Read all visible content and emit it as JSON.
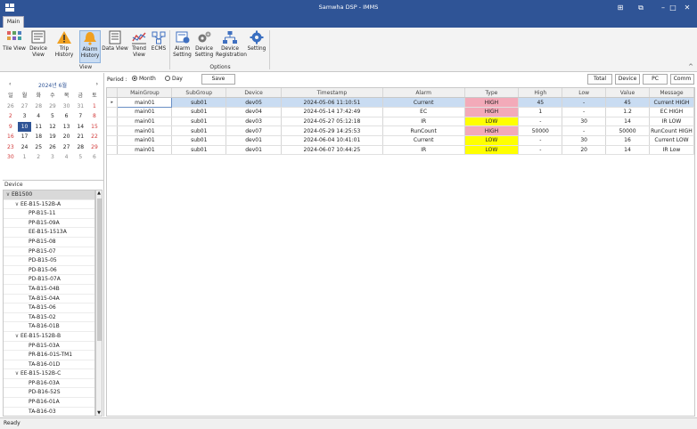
{
  "window": {
    "title": "Samwha DSP - IMMS"
  },
  "tabs": [
    "Main"
  ],
  "ribbon": {
    "buttons": [
      {
        "label": "Tile View",
        "icon": "tile-view-icon"
      },
      {
        "label": "Device View",
        "icon": "device-view-icon"
      },
      {
        "label": "Trip History",
        "icon": "warning-icon"
      },
      {
        "label": "Alarm History",
        "icon": "bell-icon"
      },
      {
        "label": "Data View",
        "icon": "document-icon"
      },
      {
        "label": "Trend View",
        "icon": "trend-icon"
      },
      {
        "label": "ECMS",
        "icon": "ecms-icon"
      },
      {
        "label": "Alarm Setting",
        "icon": "alarm-setting-icon"
      },
      {
        "label": "Device Setting",
        "icon": "gears-icon"
      },
      {
        "label": "Device Registration",
        "icon": "network-icon"
      },
      {
        "label": "Setting",
        "icon": "gear-icon"
      }
    ],
    "groups": [
      "View",
      "Options"
    ]
  },
  "calendar": {
    "month_label": "2024년 6월",
    "weekdays": [
      "일",
      "월",
      "화",
      "수",
      "목",
      "금",
      "토"
    ],
    "days": [
      [
        "26",
        "27",
        "28",
        "29",
        "30",
        "31",
        "1"
      ],
      [
        "2",
        "3",
        "4",
        "5",
        "6",
        "7",
        "8"
      ],
      [
        "9",
        "10",
        "11",
        "12",
        "13",
        "14",
        "15"
      ],
      [
        "16",
        "17",
        "18",
        "19",
        "20",
        "21",
        "22"
      ],
      [
        "23",
        "24",
        "25",
        "26",
        "27",
        "28",
        "29"
      ],
      [
        "30",
        "1",
        "2",
        "3",
        "4",
        "5",
        "6"
      ]
    ],
    "selected_day": "10"
  },
  "device_panel": {
    "header": "Device",
    "tree": [
      {
        "label": "EB1500",
        "level": 0,
        "toggle": "∨"
      },
      {
        "label": "EE-B15-152B-A",
        "level": 1,
        "toggle": "∨"
      },
      {
        "label": "PP-B15-11",
        "level": 2
      },
      {
        "label": "PP-B15-09A",
        "level": 2
      },
      {
        "label": "EE-B15-1513A",
        "level": 2
      },
      {
        "label": "PP-B15-08",
        "level": 2
      },
      {
        "label": "PP-B15-07",
        "level": 2
      },
      {
        "label": "PD-B15-05",
        "level": 2
      },
      {
        "label": "PD-B15-06",
        "level": 2
      },
      {
        "label": "PD-B15-07A",
        "level": 2
      },
      {
        "label": "TA-B15-04B",
        "level": 2
      },
      {
        "label": "TA-B15-04A",
        "level": 2
      },
      {
        "label": "TA-B15-06",
        "level": 2
      },
      {
        "label": "TA-B15-02",
        "level": 2
      },
      {
        "label": "TA-B16-01B",
        "level": 2
      },
      {
        "label": "EE-B15-152B-B",
        "level": 1,
        "toggle": "∨"
      },
      {
        "label": "PP-B15-03A",
        "level": 2
      },
      {
        "label": "PR-B16-01S-TM1",
        "level": 2
      },
      {
        "label": "TA-B16-01D",
        "level": 2
      },
      {
        "label": "EE-B15-152B-C",
        "level": 1,
        "toggle": "∨"
      },
      {
        "label": "PP-B16-03A",
        "level": 2
      },
      {
        "label": "PD-B16-52S",
        "level": 2
      },
      {
        "label": "PP-B16-01A",
        "level": 2
      },
      {
        "label": "TA-B16-03",
        "level": 2
      }
    ]
  },
  "toolbar": {
    "period_label": "Period :",
    "period_options": [
      "Month",
      "Day"
    ],
    "period_selected": "Month",
    "save_label": "Save",
    "filter_buttons": [
      "Total",
      "Device",
      "PC",
      "Comm"
    ]
  },
  "chart_data": {
    "type": "table",
    "columns": [
      "MainGroup",
      "SubGroup",
      "Device",
      "Timestamp",
      "Alarm",
      "Type",
      "High",
      "Low",
      "Value",
      "Message"
    ],
    "rows": [
      [
        "main01",
        "sub01",
        "dev05",
        "2024-05-06 11:10:51",
        "Current",
        "HIGH",
        "45",
        "-",
        "45",
        "Current HIGH"
      ],
      [
        "main01",
        "sub01",
        "dev04",
        "2024-05-14 17:42:49",
        "EC",
        "HIGH",
        "1",
        "-",
        "1.2",
        "EC HIGH"
      ],
      [
        "main01",
        "sub01",
        "dev03",
        "2024-05-27 05:12:18",
        "IR",
        "LOW",
        "-",
        "30",
        "14",
        "IR LOW"
      ],
      [
        "main01",
        "sub01",
        "dev07",
        "2024-05-29 14:25:53",
        "RunCount",
        "HIGH",
        "50000",
        "-",
        "50000",
        "RunCount HIGH"
      ],
      [
        "main01",
        "sub01",
        "dev01",
        "2024-06-04 10:41:01",
        "Current",
        "LOW",
        "-",
        "30",
        "16",
        "Current LOW"
      ],
      [
        "main01",
        "sub01",
        "dev01",
        "2024-06-07 10:44:25",
        "IR",
        "LOW",
        "-",
        "20",
        "14",
        "IR Low"
      ]
    ],
    "type_colors": {
      "HIGH": "#f3aab9",
      "LOW": "#ffff00"
    }
  },
  "status": {
    "text": "Ready"
  },
  "colors": {
    "titlebar": "#2f5496",
    "selection": "#c9dcf2"
  }
}
